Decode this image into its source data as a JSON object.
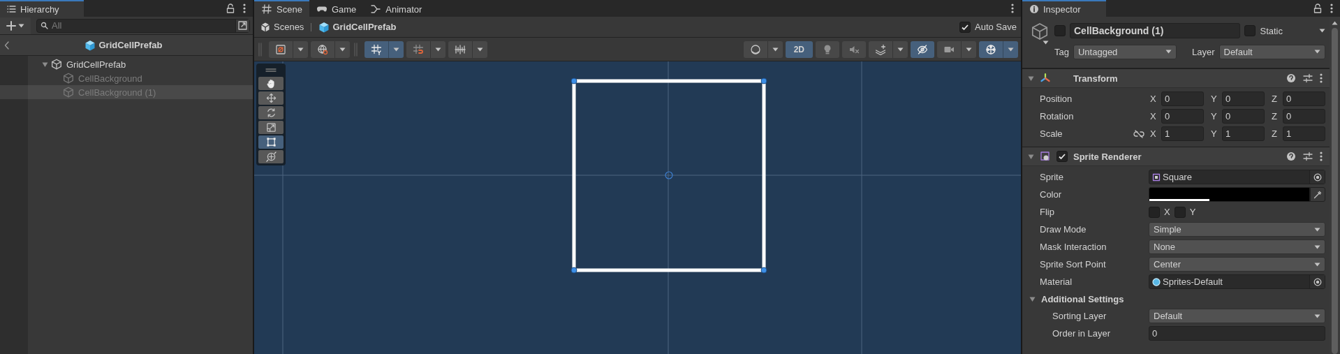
{
  "hierarchy": {
    "title": "Hierarchy",
    "search": {
      "placeholder": "All"
    },
    "prefab_title": "GridCellPrefab",
    "items": [
      {
        "label": "GridCellPrefab",
        "active": true,
        "selected": false,
        "expanded": true,
        "children": [
          {
            "label": "CellBackground",
            "active": false,
            "selected": false
          },
          {
            "label": "CellBackground (1)",
            "active": false,
            "selected": true
          }
        ]
      }
    ]
  },
  "scene": {
    "tabs": [
      {
        "kind": "scene",
        "label": "Scene",
        "selected": true
      },
      {
        "kind": "game",
        "label": "Game",
        "selected": false
      },
      {
        "kind": "animator",
        "label": "Animator",
        "selected": false
      }
    ],
    "breadcrumbs": [
      {
        "kind": "scenes",
        "label": "Scenes"
      },
      {
        "kind": "prefab",
        "label": "GridCellPrefab"
      }
    ],
    "auto_save": {
      "label": "Auto Save",
      "checked": true
    },
    "toolbar_left": [
      {
        "kind": "draw-mode",
        "on": false,
        "dropdown": true
      },
      {
        "kind": "globe",
        "on": false,
        "dropdown": true
      },
      {
        "kind": "grid",
        "on": true,
        "dropdown": true
      },
      {
        "kind": "snap",
        "on": false,
        "dropdown": true
      },
      {
        "kind": "increment",
        "on": false,
        "dropdown": true
      }
    ],
    "toolbar_right": [
      {
        "kind": "shading",
        "on": false,
        "dropdown": true
      },
      {
        "kind": "text",
        "label": "2D",
        "on": true,
        "dropdown": false
      },
      {
        "kind": "light",
        "on": false,
        "dropdown": false
      },
      {
        "kind": "audio",
        "on": false,
        "dropdown": false
      },
      {
        "kind": "layers",
        "on": false,
        "dropdown": true
      },
      {
        "kind": "visibility",
        "on": true,
        "dropdown": false
      },
      {
        "kind": "camera",
        "on": false,
        "dropdown": true
      },
      {
        "kind": "gizmos",
        "on": true,
        "dropdown": true
      }
    ],
    "tools": [
      {
        "kind": "hand",
        "selected": false
      },
      {
        "kind": "move",
        "selected": false
      },
      {
        "kind": "rotate",
        "selected": false
      },
      {
        "kind": "scale",
        "selected": false
      },
      {
        "kind": "rect",
        "selected": true
      },
      {
        "kind": "transform",
        "selected": false
      }
    ]
  },
  "inspector": {
    "title": "Inspector",
    "object": {
      "active": false,
      "name": "CellBackground (1)",
      "static": {
        "label": "Static",
        "checked": false
      },
      "tag": {
        "label": "Tag",
        "value": "Untagged"
      },
      "layer": {
        "label": "Layer",
        "value": "Default"
      }
    },
    "components": [
      {
        "kind": "transform",
        "title": "Transform",
        "expanded": true,
        "rows": [
          {
            "kind": "vector",
            "label": "Position",
            "axes": [
              {
                "axis": "X",
                "value": "0"
              },
              {
                "axis": "Y",
                "value": "0"
              },
              {
                "axis": "Z",
                "value": "0"
              }
            ]
          },
          {
            "kind": "vector",
            "label": "Rotation",
            "axes": [
              {
                "axis": "X",
                "value": "0"
              },
              {
                "axis": "Y",
                "value": "0"
              },
              {
                "axis": "Z",
                "value": "0"
              }
            ]
          },
          {
            "kind": "scale",
            "label": "Scale",
            "linked": false,
            "axes": [
              {
                "axis": "X",
                "value": "1"
              },
              {
                "axis": "Y",
                "value": "1"
              },
              {
                "axis": "Z",
                "value": "1"
              }
            ]
          }
        ]
      },
      {
        "kind": "sprite-renderer",
        "title": "Sprite Renderer",
        "enabled": true,
        "expanded": true,
        "rows": [
          {
            "kind": "sprite-object",
            "label": "Sprite",
            "value": "Square"
          },
          {
            "kind": "color",
            "label": "Color",
            "color": "#000000",
            "level": 0.375
          },
          {
            "kind": "flip",
            "label": "Flip",
            "options": [
              {
                "label": "X",
                "checked": false
              },
              {
                "label": "Y",
                "checked": false
              }
            ]
          },
          {
            "kind": "dropdown",
            "label": "Draw Mode",
            "value": "Simple"
          },
          {
            "kind": "dropdown",
            "label": "Mask Interaction",
            "value": "None"
          },
          {
            "kind": "dropdown",
            "label": "Sprite Sort Point",
            "value": "Center"
          },
          {
            "kind": "material-object",
            "label": "Material",
            "value": "Sprites-Default"
          },
          {
            "kind": "section",
            "label": "Additional Settings",
            "expanded": true,
            "children": [
              {
                "kind": "dropdown",
                "label": "Sorting Layer",
                "value": "Default"
              },
              {
                "kind": "number",
                "label": "Order in Layer",
                "value": "0"
              }
            ]
          }
        ]
      }
    ]
  }
}
